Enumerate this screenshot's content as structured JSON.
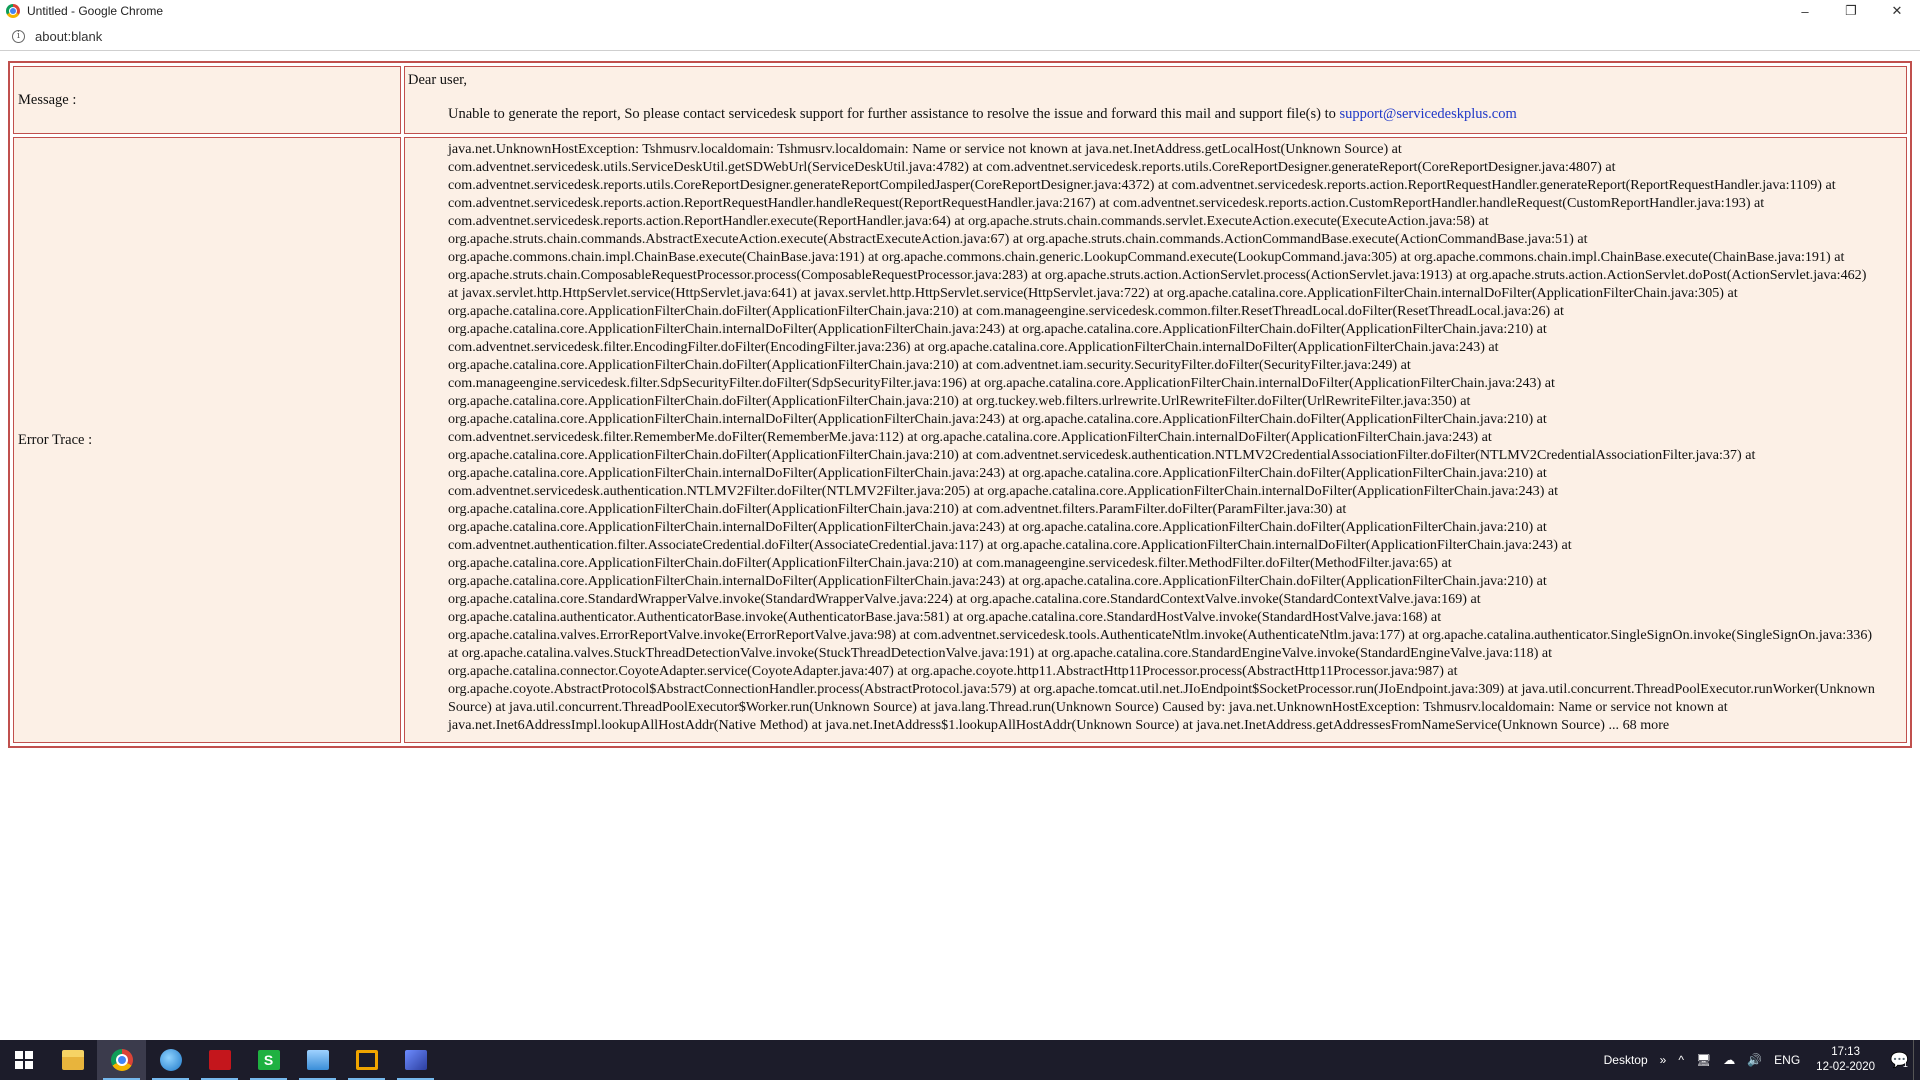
{
  "window": {
    "title": "Untitled - Google Chrome",
    "minimize_glyph": "–",
    "maximize_glyph": "❐",
    "close_glyph": "✕"
  },
  "address_bar": {
    "info_glyph": "i",
    "url": "about:blank"
  },
  "report": {
    "message_label": "Message :",
    "greeting": "Dear user,",
    "message_text": "Unable to generate the report, So please contact servicedesk support for further assistance to resolve the issue and forward this mail and support file(s) to ",
    "support_email": "support@servicedeskplus.com",
    "error_label": "Error Trace :",
    "error_trace": "java.net.UnknownHostException: Tshmusrv.localdomain: Tshmusrv.localdomain: Name or service not known at java.net.InetAddress.getLocalHost(Unknown Source) at com.adventnet.servicedesk.utils.ServiceDeskUtil.getSDWebUrl(ServiceDeskUtil.java:4782) at com.adventnet.servicedesk.reports.utils.CoreReportDesigner.generateReport(CoreReportDesigner.java:4807) at com.adventnet.servicedesk.reports.utils.CoreReportDesigner.generateReportCompiledJasper(CoreReportDesigner.java:4372) at com.adventnet.servicedesk.reports.action.ReportRequestHandler.generateReport(ReportRequestHandler.java:1109) at com.adventnet.servicedesk.reports.action.ReportRequestHandler.handleRequest(ReportRequestHandler.java:2167) at com.adventnet.servicedesk.reports.action.CustomReportHandler.handleRequest(CustomReportHandler.java:193) at com.adventnet.servicedesk.reports.action.ReportHandler.execute(ReportHandler.java:64) at org.apache.struts.chain.commands.servlet.ExecuteAction.execute(ExecuteAction.java:58) at org.apache.struts.chain.commands.AbstractExecuteAction.execute(AbstractExecuteAction.java:67) at org.apache.struts.chain.commands.ActionCommandBase.execute(ActionCommandBase.java:51) at org.apache.commons.chain.impl.ChainBase.execute(ChainBase.java:191) at org.apache.commons.chain.generic.LookupCommand.execute(LookupCommand.java:305) at org.apache.commons.chain.impl.ChainBase.execute(ChainBase.java:191) at org.apache.struts.chain.ComposableRequestProcessor.process(ComposableRequestProcessor.java:283) at org.apache.struts.action.ActionServlet.process(ActionServlet.java:1913) at org.apache.struts.action.ActionServlet.doPost(ActionServlet.java:462) at javax.servlet.http.HttpServlet.service(HttpServlet.java:641) at javax.servlet.http.HttpServlet.service(HttpServlet.java:722) at org.apache.catalina.core.ApplicationFilterChain.internalDoFilter(ApplicationFilterChain.java:305) at org.apache.catalina.core.ApplicationFilterChain.doFilter(ApplicationFilterChain.java:210) at com.manageengine.servicedesk.common.filter.ResetThreadLocal.doFilter(ResetThreadLocal.java:26) at org.apache.catalina.core.ApplicationFilterChain.internalDoFilter(ApplicationFilterChain.java:243) at org.apache.catalina.core.ApplicationFilterChain.doFilter(ApplicationFilterChain.java:210) at com.adventnet.servicedesk.filter.EncodingFilter.doFilter(EncodingFilter.java:236) at org.apache.catalina.core.ApplicationFilterChain.internalDoFilter(ApplicationFilterChain.java:243) at org.apache.catalina.core.ApplicationFilterChain.doFilter(ApplicationFilterChain.java:210) at com.adventnet.iam.security.SecurityFilter.doFilter(SecurityFilter.java:249) at com.manageengine.servicedesk.filter.SdpSecurityFilter.doFilter(SdpSecurityFilter.java:196) at org.apache.catalina.core.ApplicationFilterChain.internalDoFilter(ApplicationFilterChain.java:243) at org.apache.catalina.core.ApplicationFilterChain.doFilter(ApplicationFilterChain.java:210) at org.tuckey.web.filters.urlrewrite.UrlRewriteFilter.doFilter(UrlRewriteFilter.java:350) at org.apache.catalina.core.ApplicationFilterChain.internalDoFilter(ApplicationFilterChain.java:243) at org.apache.catalina.core.ApplicationFilterChain.doFilter(ApplicationFilterChain.java:210) at com.adventnet.servicedesk.filter.RememberMe.doFilter(RememberMe.java:112) at org.apache.catalina.core.ApplicationFilterChain.internalDoFilter(ApplicationFilterChain.java:243) at org.apache.catalina.core.ApplicationFilterChain.doFilter(ApplicationFilterChain.java:210) at com.adventnet.servicedesk.authentication.NTLMV2CredentialAssociationFilter.doFilter(NTLMV2CredentialAssociationFilter.java:37) at org.apache.catalina.core.ApplicationFilterChain.internalDoFilter(ApplicationFilterChain.java:243) at org.apache.catalina.core.ApplicationFilterChain.doFilter(ApplicationFilterChain.java:210) at com.adventnet.servicedesk.authentication.NTLMV2Filter.doFilter(NTLMV2Filter.java:205) at org.apache.catalina.core.ApplicationFilterChain.internalDoFilter(ApplicationFilterChain.java:243) at org.apache.catalina.core.ApplicationFilterChain.doFilter(ApplicationFilterChain.java:210) at com.adventnet.filters.ParamFilter.doFilter(ParamFilter.java:30) at org.apache.catalina.core.ApplicationFilterChain.internalDoFilter(ApplicationFilterChain.java:243) at org.apache.catalina.core.ApplicationFilterChain.doFilter(ApplicationFilterChain.java:210) at com.adventnet.authentication.filter.AssociateCredential.doFilter(AssociateCredential.java:117) at org.apache.catalina.core.ApplicationFilterChain.internalDoFilter(ApplicationFilterChain.java:243) at org.apache.catalina.core.ApplicationFilterChain.doFilter(ApplicationFilterChain.java:210) at com.manageengine.servicedesk.filter.MethodFilter.doFilter(MethodFilter.java:65) at org.apache.catalina.core.ApplicationFilterChain.internalDoFilter(ApplicationFilterChain.java:243) at org.apache.catalina.core.ApplicationFilterChain.doFilter(ApplicationFilterChain.java:210) at org.apache.catalina.core.StandardWrapperValve.invoke(StandardWrapperValve.java:224) at org.apache.catalina.core.StandardContextValve.invoke(StandardContextValve.java:169) at org.apache.catalina.authenticator.AuthenticatorBase.invoke(AuthenticatorBase.java:581) at org.apache.catalina.core.StandardHostValve.invoke(StandardHostValve.java:168) at org.apache.catalina.valves.ErrorReportValve.invoke(ErrorReportValve.java:98) at com.adventnet.servicedesk.tools.AuthenticateNtlm.invoke(AuthenticateNtlm.java:177) at org.apache.catalina.authenticator.SingleSignOn.invoke(SingleSignOn.java:336) at org.apache.catalina.valves.StuckThreadDetectionValve.invoke(StuckThreadDetectionValve.java:191) at org.apache.catalina.core.StandardEngineValve.invoke(StandardEngineValve.java:118) at org.apache.catalina.connector.CoyoteAdapter.service(CoyoteAdapter.java:407) at org.apache.coyote.http11.AbstractHttp11Processor.process(AbstractHttp11Processor.java:987) at org.apache.coyote.AbstractProtocol$AbstractConnectionHandler.process(AbstractProtocol.java:579) at org.apache.tomcat.util.net.JIoEndpoint$SocketProcessor.run(JIoEndpoint.java:309) at java.util.concurrent.ThreadPoolExecutor.runWorker(Unknown Source) at java.util.concurrent.ThreadPoolExecutor$Worker.run(Unknown Source) at java.lang.Thread.run(Unknown Source) Caused by: java.net.UnknownHostException: Tshmusrv.localdomain: Name or service not known at java.net.Inet6AddressImpl.lookupAllHostAddr(Native Method) at java.net.InetAddress$1.lookupAllHostAddr(Unknown Source) at java.net.InetAddress.getAddressesFromNameService(Unknown Source) ... 68 more"
  },
  "taskbar": {
    "apps": [
      {
        "icon": "file-explorer-icon"
      },
      {
        "icon": "chrome-icon"
      },
      {
        "icon": "globe-icon"
      },
      {
        "icon": "acrobat-pdf-icon"
      },
      {
        "icon": "s-app-icon",
        "glyph": "S"
      },
      {
        "icon": "remote-desktop-icon"
      },
      {
        "icon": "orange-box-icon"
      },
      {
        "icon": "tool-app-icon"
      }
    ],
    "desktop_label": "Desktop",
    "toolbar_chevron": "»",
    "tray_up_arrow": "^",
    "network_glyph": "🖥",
    "onedrive_glyph": "☁",
    "volume_glyph": "🔊",
    "language": "ENG",
    "time": "17:13",
    "date": "12-02-2020",
    "notification_glyph": "💬",
    "notification_count": "1"
  },
  "colors": {
    "table_border": "#c0504d",
    "cell_background": "#fcf0e6",
    "link": "#1f38c8",
    "taskbar": "#1c1c2a"
  }
}
